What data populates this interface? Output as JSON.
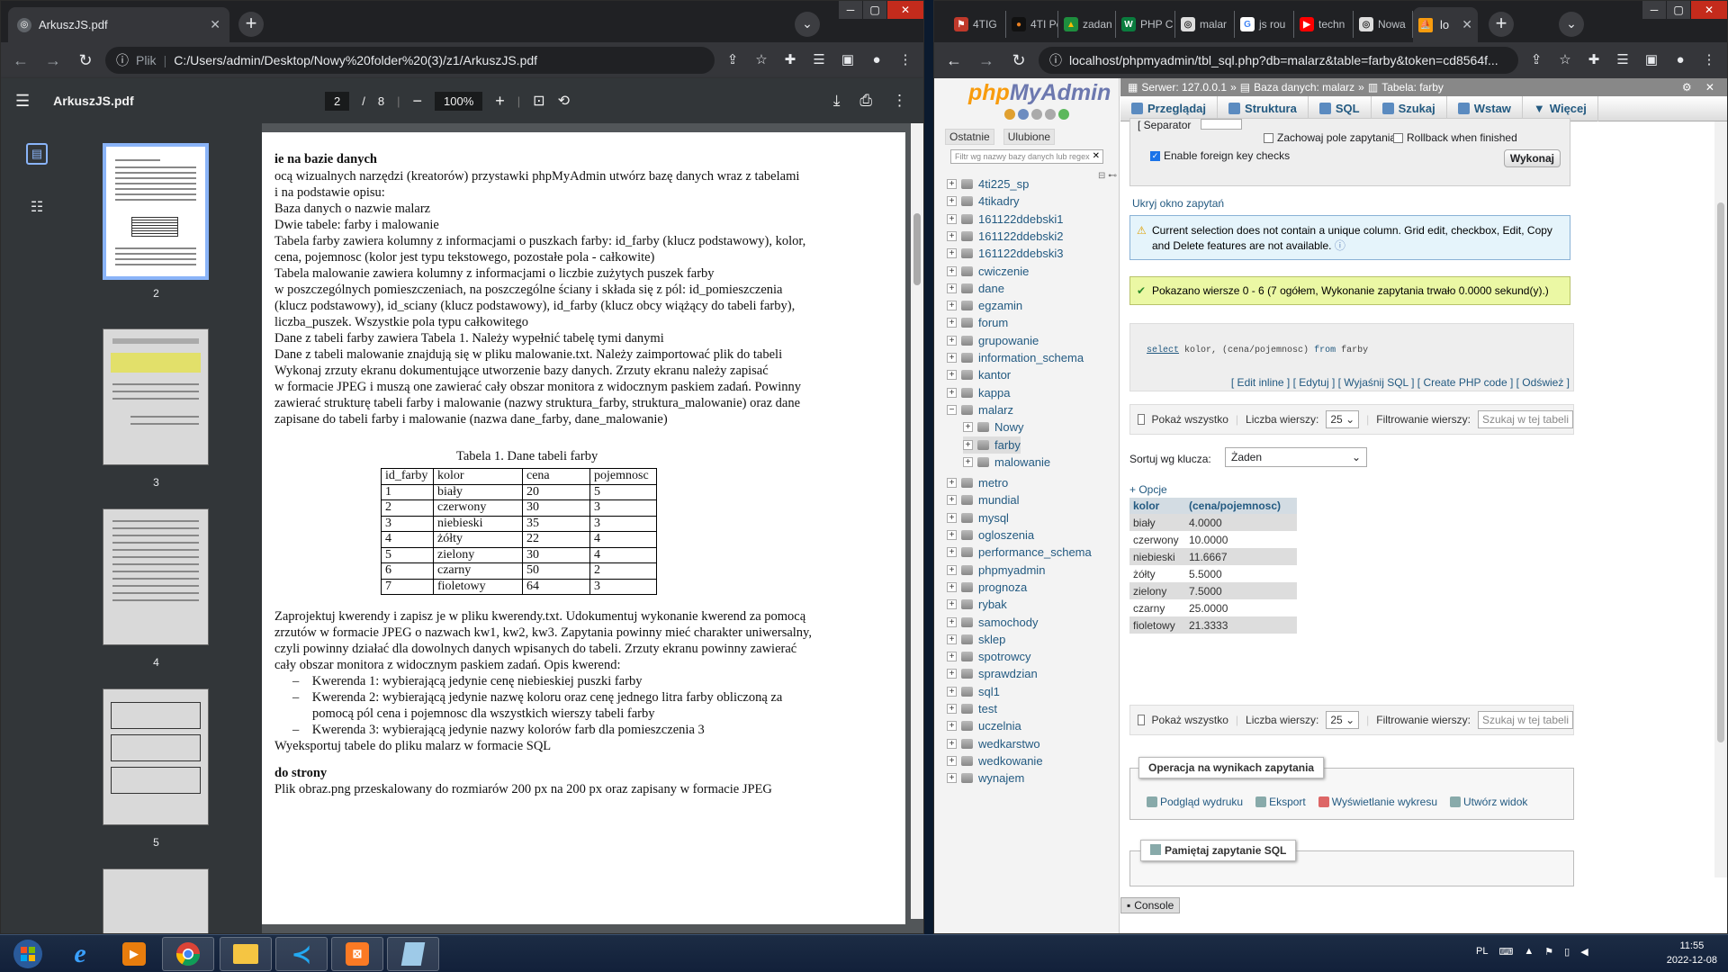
{
  "left_window": {
    "tab_title": "ArkuszJS.pdf",
    "address_label": "Plik",
    "address_url": "C:/Users/admin/Desktop/Nowy%20folder%20(3)/z1/ArkuszJS.pdf",
    "pdf_toolbar": {
      "file_name": "ArkuszJS.pdf",
      "current_page": "2",
      "page_separator": "/",
      "total_pages": "8",
      "zoom": "100%"
    },
    "thumbnails": [
      "2",
      "3",
      "4",
      "5"
    ],
    "page": {
      "heading": "ie na bazie danych",
      "lines": [
        "ocą wizualnych narzędzi (kreatorów) przystawki phpMyAdmin utwórz bazę danych wraz z tabelami",
        "i na podstawie opisu:",
        "Baza danych o nazwie malarz",
        "Dwie tabele: farby i malowanie",
        "Tabela farby zawiera kolumny z informacjami o puszkach farby: id_farby (klucz podstawowy), kolor,",
        "cena, pojemnosc (kolor jest typu tekstowego, pozostałe pola - całkowite)",
        "Tabela malowanie zawiera kolumny z informacjami o liczbie zużytych puszek farby",
        "w poszczególnych pomieszczeniach, na poszczególne ściany i składa się z pól: id_pomieszczenia",
        "(klucz podstawowy), id_sciany (klucz podstawowy), id_farby (klucz obcy wiążący do tabeli farby),",
        "liczba_puszek. Wszystkie pola typu całkowitego",
        "Dane z tabeli farby zawiera Tabela 1. Należy wypełnić tabelę tymi danymi",
        "Dane z tabeli malowanie znajdują się w pliku malowanie.txt. Należy zaimportować plik do tabeli",
        "Wykonaj zrzuty ekranu dokumentujące utworzenie bazy danych. Zrzuty ekranu należy zapisać",
        "w formacie JPEG i muszą one zawierać cały obszar monitora z widocznym paskiem zadań. Powinny",
        "zawierać strukturę tabeli farby i malowanie (nazwy struktura_farby, struktura_malowanie) oraz dane",
        "zapisane do tabeli farby i malowanie (nazwa dane_farby, dane_malowanie)"
      ],
      "table_caption": "Tabela 1. Dane tabeli farby",
      "table_headers": [
        "id_farby",
        "kolor",
        "cena",
        "pojemnosc"
      ],
      "table_rows": [
        [
          "1",
          "biały",
          "20",
          "5"
        ],
        [
          "2",
          "czerwony",
          "30",
          "3"
        ],
        [
          "3",
          "niebieski",
          "35",
          "3"
        ],
        [
          "4",
          "żółty",
          "22",
          "4"
        ],
        [
          "5",
          "zielony",
          "30",
          "4"
        ],
        [
          "6",
          "czarny",
          "50",
          "2"
        ],
        [
          "7",
          "fioletowy",
          "64",
          "3"
        ]
      ],
      "lines2": [
        "Zaprojektuj kwerendy i zapisz je w pliku kwerendy.txt. Udokumentuj wykonanie kwerend za pomocą",
        "zrzutów w formacie JPEG o nazwach kw1, kw2, kw3. Zapytania powinny mieć charakter uniwersalny,",
        "czyli powinny działać dla dowolnych danych wpisanych do tabeli. Zrzuty ekranu powinny zawierać",
        "cały obszar monitora z widocznym paskiem zadań. Opis kwerend:"
      ],
      "bullets": [
        "Kwerenda 1: wybierającą jedynie cenę niebieskiej puszki farby",
        "Kwerenda 2: wybierającą jedynie nazwę koloru oraz cenę jednego litra farby obliczoną za",
        "pomocą pól cena i pojemnosc dla wszystkich wierszy tabeli farby",
        "Kwerenda 3: wybierającą jedynie nazwy kolorów farb dla pomieszczenia 3"
      ],
      "export_line": "Wyeksportuj tabele do pliku malarz w formacie SQL",
      "heading2": "do strony",
      "last_line": "Plik obraz.png przeskalowany do rozmiarów 200 px na 200 px oraz zapisany w formacie JPEG"
    }
  },
  "right_window": {
    "tabs": [
      "4TIG",
      "4TI Pc",
      "zadan",
      "PHP C",
      "malar",
      "js rou",
      "techn",
      "Nowa",
      "lo"
    ],
    "address_url": "localhost/phpmyadmin/tbl_sql.php?db=malarz&table=farby&token=cd8564f...",
    "pma": {
      "logo_php": "php",
      "logo_myadmin": "MyAdmin",
      "nav_tab_recent": "Ostatnie",
      "nav_tab_fav": "Ulubione",
      "filter_placeholder": "Filtr wg nazwy bazy danych lub regex",
      "databases": [
        "4ti225_sp",
        "4tikadry",
        "161122ddebski1",
        "161122ddebski2",
        "161122ddebski3",
        "cwiczenie",
        "dane",
        "egzamin",
        "forum",
        "grupowanie",
        "information_schema",
        "kantor",
        "kappa",
        "malarz"
      ],
      "malarz_children": [
        "Nowy",
        "farby",
        "malowanie"
      ],
      "databases2": [
        "metro",
        "mundial",
        "mysql",
        "ogloszenia",
        "performance_schema",
        "phpmyadmin",
        "prognoza",
        "rybak",
        "samochody",
        "sklep",
        "spotrowcy",
        "sprawdzian",
        "sql1",
        "test",
        "uczelnia",
        "wedkarstwo",
        "wedkowanie",
        "wynajem"
      ],
      "breadcrumb": [
        "Serwer: 127.0.0.1",
        "Baza danych: malarz",
        "Tabela: farby"
      ],
      "menu": [
        "Przeglądaj",
        "Struktura",
        "SQL",
        "Szukaj",
        "Wstaw",
        "Więcej"
      ],
      "separator_label": "[ Separator",
      "retain_query": "Zachowaj pole zapytania",
      "rollback": "Rollback when finished",
      "foreign_key": "Enable foreign key checks",
      "execute_button": "Wykonaj",
      "hide_query": "Ukryj okno zapytań",
      "warning": "Current selection does not contain a unique column. Grid edit, checkbox, Edit, Copy and Delete features are not available.",
      "success": "Pokazano wiersze 0 - 6 (7 ogółem, Wykonanie zapytania trwało 0.0000 sekund(y).)",
      "sql_keywords": [
        "select",
        "from"
      ],
      "sql_text_1": "kolor, (cena/pojemnosc)",
      "sql_text_2": "farby",
      "links": [
        "[ Edit inline ]",
        "[ Edytuj ]",
        "[ Wyjaśnij SQL ]",
        "[ Create PHP code ]",
        "[ Odśwież ]"
      ],
      "show_all": "Pokaż wszystko",
      "rows_label": "Liczba wierszy:",
      "rows_value": "25",
      "filter_rows_label": "Filtrowanie wierszy:",
      "filter_rows_placeholder": "Szukaj w tej tabeli",
      "sort_label": "Sortuj wg klucza:",
      "sort_value": "Żaden",
      "options": "+ Opcje",
      "result_headers": [
        "kolor",
        "(cena/pojemnosc)"
      ],
      "result_rows": [
        [
          "biały",
          "4.0000"
        ],
        [
          "czerwony",
          "10.0000"
        ],
        [
          "niebieski",
          "11.6667"
        ],
        [
          "żółty",
          "5.5000"
        ],
        [
          "zielony",
          "7.5000"
        ],
        [
          "czarny",
          "25.0000"
        ],
        [
          "fioletowy",
          "21.3333"
        ]
      ],
      "ops_legend": "Operacja na wynikach zapytania",
      "ops": [
        "Podgląd wydruku",
        "Eksport",
        "Wyświetlanie wykresu",
        "Utwórz widok"
      ],
      "bookmark_legend": "Pamiętaj zapytanie SQL",
      "console": "Console"
    }
  },
  "taskbar": {
    "lang": "PL",
    "time": "11:55",
    "date": "2022-12-08"
  }
}
